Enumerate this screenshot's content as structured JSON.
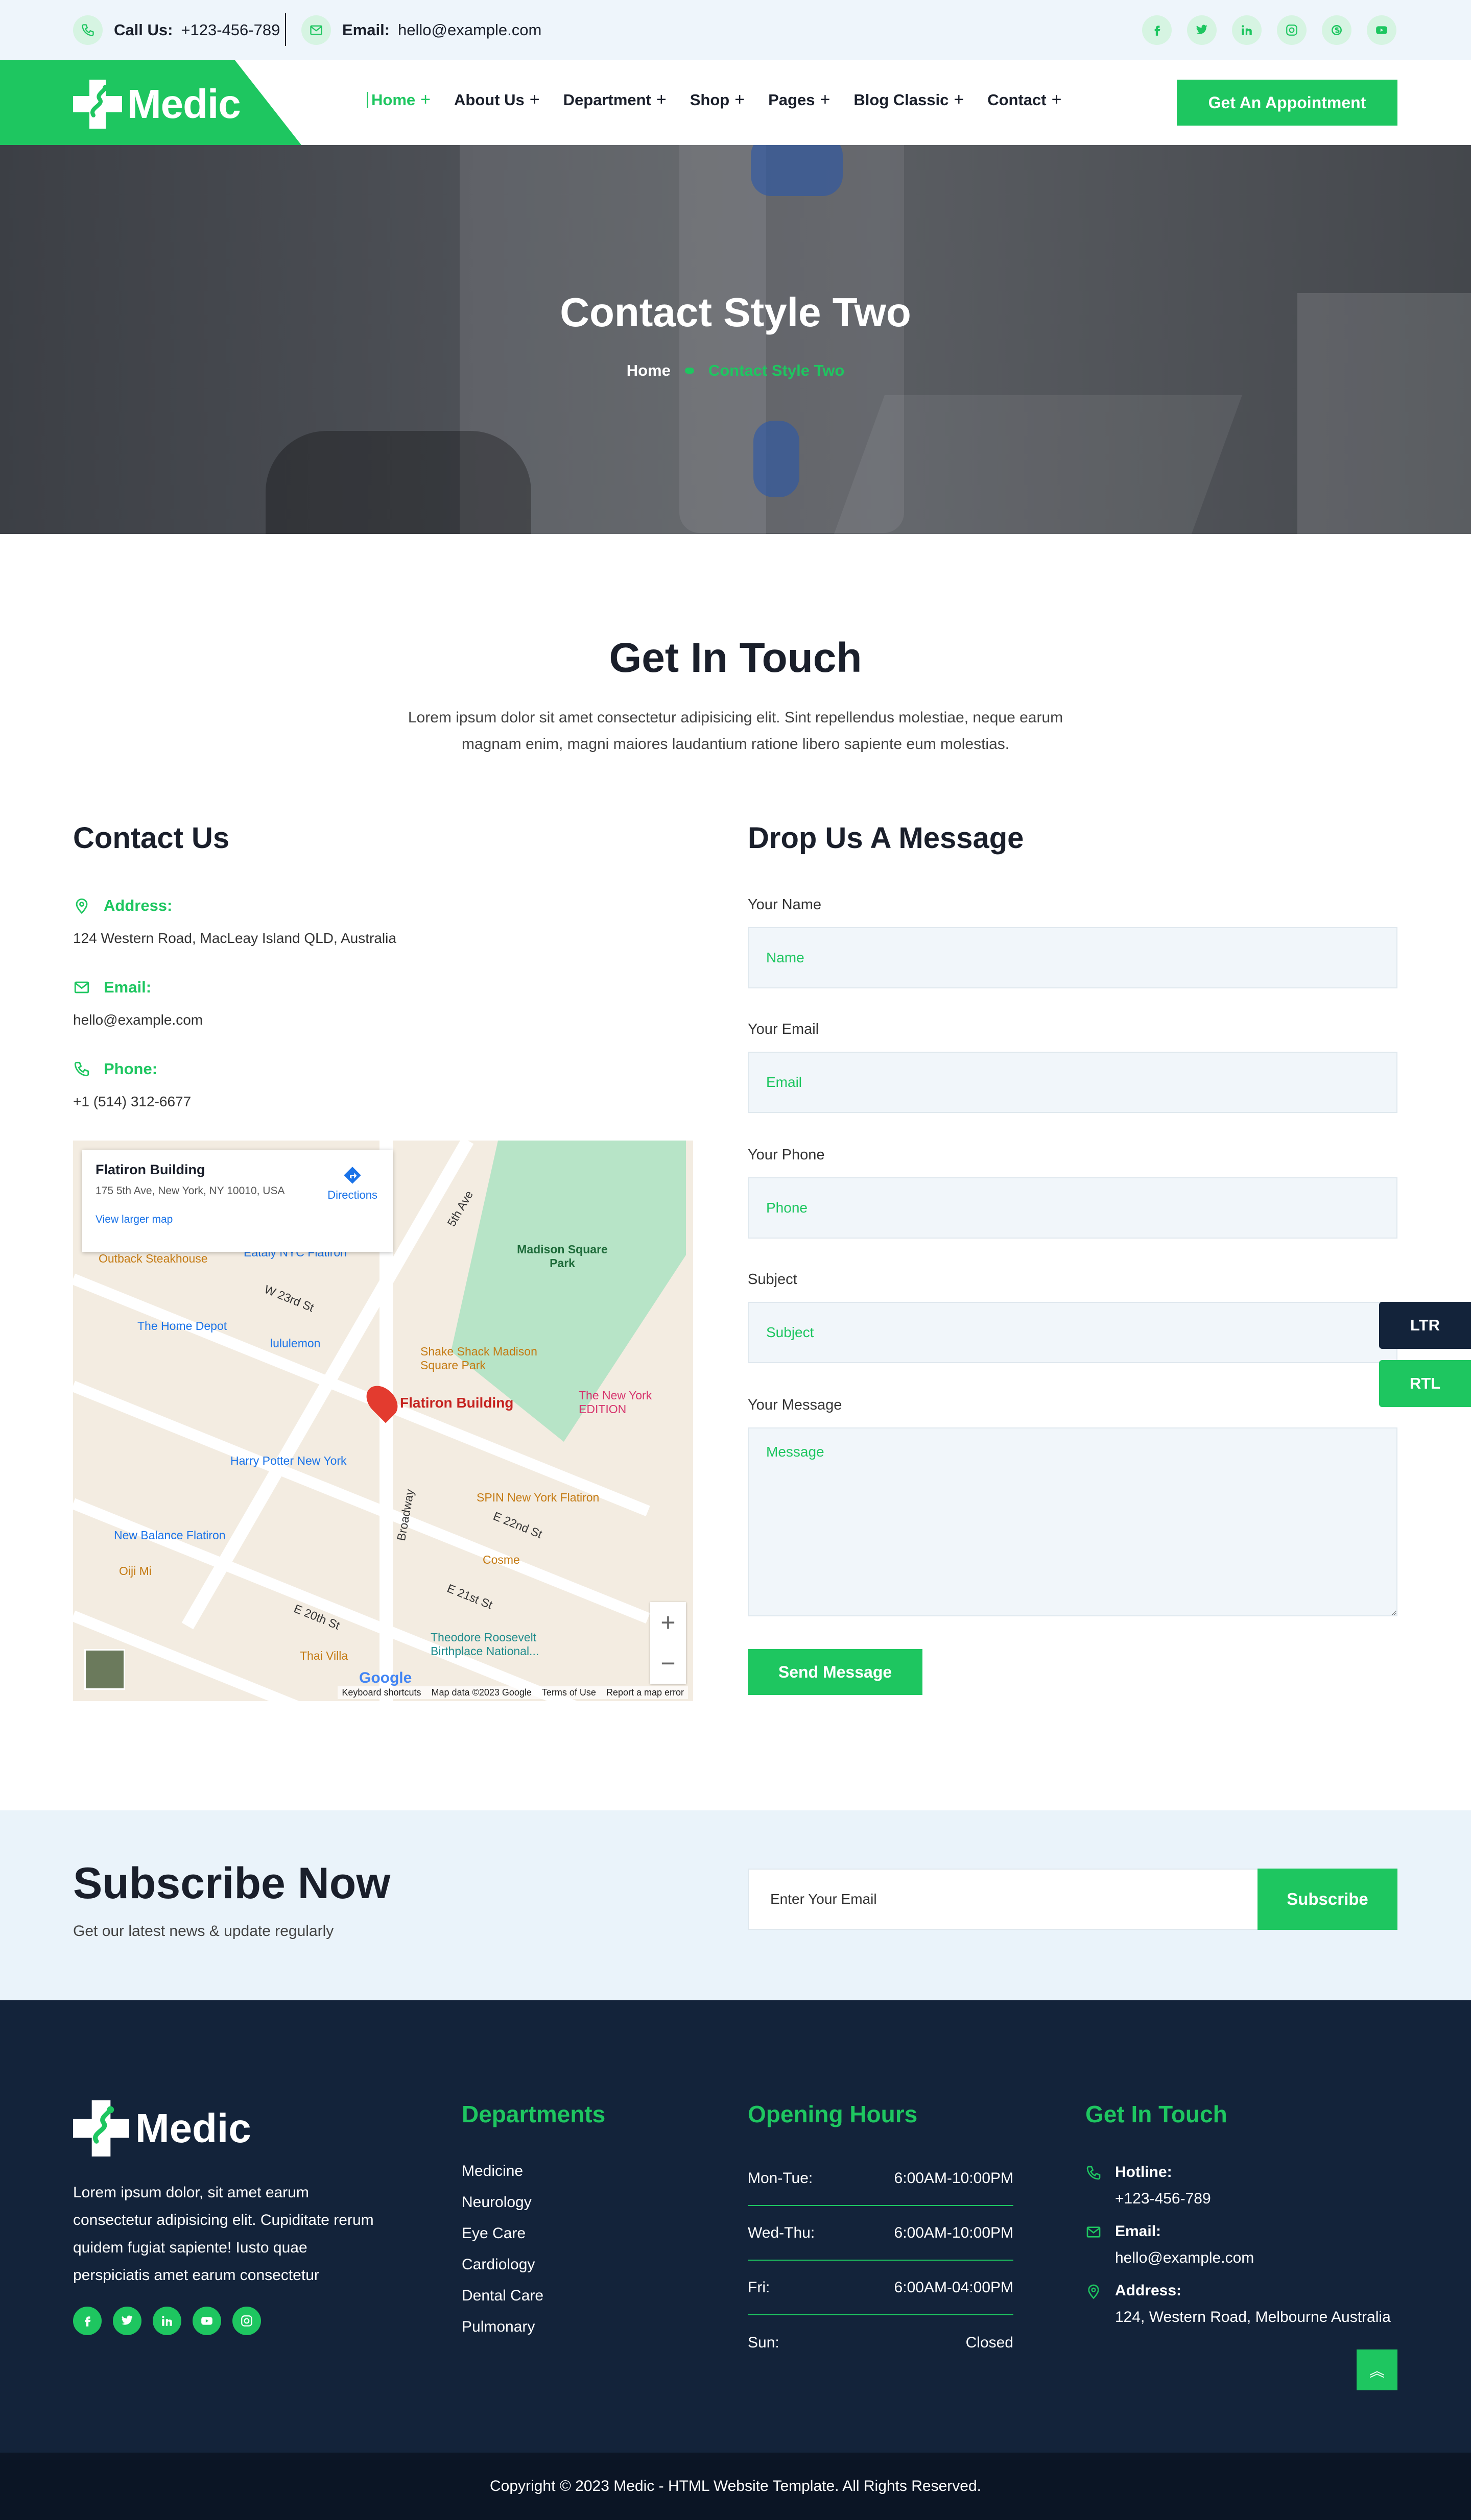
{
  "topbar": {
    "call_label": "Call Us:",
    "call_value": "+123-456-789",
    "email_label": "Email:",
    "email_value": "hello@example.com",
    "socials": [
      "facebook-icon",
      "twitter-icon",
      "linkedin-icon",
      "instagram-icon",
      "skype-icon",
      "youtube-icon"
    ]
  },
  "brand": {
    "name": "Medic",
    "accent": "#1ec660",
    "dark": "#13233a"
  },
  "nav": {
    "items": [
      "Home",
      "About Us",
      "Department",
      "Shop",
      "Pages",
      "Blog Classic",
      "Contact"
    ],
    "active": "Home",
    "cta": "Get An Appointment"
  },
  "hero": {
    "title": "Contact Style Two",
    "breadcrumb_home": "Home",
    "breadcrumb_current": "Contact Style Two"
  },
  "touch": {
    "title": "Get In Touch",
    "desc": "Lorem ipsum dolor sit amet consectetur adipisicing elit. Sint repellendus molestiae, neque earum magnam enim, magni maiores laudantium ratione libero sapiente eum molestias."
  },
  "contact": {
    "title": "Contact Us",
    "address_label": "Address:",
    "address_value": "124 Western Road, MacLeay Island QLD, Australia",
    "email_label": "Email:",
    "email_value": "hello@example.com",
    "phone_label": "Phone:",
    "phone_value": "+1 (514) 312-6677"
  },
  "map": {
    "place_name": "Flatiron Building",
    "place_address": "175 5th Ave, New York, NY 10010, USA",
    "directions": "Directions",
    "larger_map": "View larger map",
    "pin_label": "Flatiron Building",
    "labels": [
      "Madison Square Park",
      "Shake Shack Madison Square Park",
      "Harry Potter New York",
      "The Home Depot",
      "lululemon",
      "Outback Steakhouse",
      "SPIN New York Flatiron",
      "Cosme",
      "Thai Villa",
      "New Balance Flatiron",
      "Theodore Roosevelt Birthplace National...",
      "The New York EDITION",
      "Eataly NYC Flatiron",
      "Oiji Mi",
      "W 23rd St",
      "E 22nd St",
      "E 21st St",
      "E 20th St",
      "5th Ave",
      "Broadway"
    ],
    "attribution": [
      "Keyboard shortcuts",
      "Map data ©2023 Google",
      "Terms of Use",
      "Report a map error"
    ],
    "google": "Google"
  },
  "form": {
    "title": "Drop Us A Message",
    "name_label": "Your Name",
    "name_placeholder": "Name",
    "email_label": "Your Email",
    "email_placeholder": "Email",
    "phone_label": "Your Phone",
    "phone_placeholder": "Phone",
    "subject_label": "Subject",
    "subject_placeholder": "Subject",
    "message_label": "Your Message",
    "message_placeholder": "Message",
    "submit": "Send Message"
  },
  "direction_buttons": {
    "ltr": "LTR",
    "rtl": "RTL"
  },
  "subscribe": {
    "title": "Subscribe Now",
    "desc": "Get our latest news & update regularly",
    "placeholder": "Enter Your Email",
    "button": "Subscribe"
  },
  "footer": {
    "desc": "Lorem ipsum dolor, sit amet earum consectetur adipisicing elit. Cupiditate rerum quidem fugiat sapiente! Iusto quae perspiciatis amet earum consectetur",
    "departments_title": "Departments",
    "departments": [
      "Medicine",
      "Neurology",
      "Eye Care",
      "Cardiology",
      "Dental Care",
      "Pulmonary"
    ],
    "hours_title": "Opening Hours",
    "hours": [
      {
        "day": "Mon-Tue:",
        "time": "6:00AM-10:00PM"
      },
      {
        "day": "Wed-Thu:",
        "time": "6:00AM-10:00PM"
      },
      {
        "day": "Fri:",
        "time": "6:00AM-04:00PM"
      },
      {
        "day": "Sun:",
        "time": "Closed"
      }
    ],
    "git_title": "Get In Touch",
    "hotline_label": "Hotline:",
    "hotline_value": "+123-456-789",
    "email_label": "Email:",
    "email_value": "hello@example.com",
    "address_label": "Address:",
    "address_value": "124, Western Road, Melbourne Australia",
    "copyright": "Copyright © 2023 Medic - HTML Website Template. All Rights Reserved."
  }
}
